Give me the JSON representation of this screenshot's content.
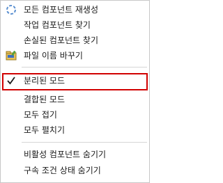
{
  "menu": {
    "items": [
      {
        "label": "모든 컴포넌트 재생성",
        "icon": "regenerate-icon"
      },
      {
        "label": "작업 컴포넌트 찾기"
      },
      {
        "label": "손실된 컴포넌트 찾기"
      },
      {
        "label": "파일 이름 바꾸기",
        "icon": "rename-file-icon"
      },
      {
        "label": "분리된 모드",
        "icon": "checkmark-icon",
        "checked": true
      },
      {
        "label": "결합된 모드"
      },
      {
        "label": "모두 접기"
      },
      {
        "label": "모두 펼치기"
      },
      {
        "label": "비활성 컴포넌트 숨기기"
      },
      {
        "label": "구속 조건 상태 숨기기"
      }
    ]
  },
  "colors": {
    "highlight_border": "#d10000",
    "separator": "#d6d6d6",
    "menu_border": "#c7c7c7"
  }
}
